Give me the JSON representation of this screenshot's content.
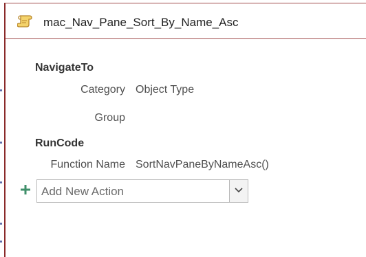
{
  "macro": {
    "title": "mac_Nav_Pane_Sort_By_Name_Asc",
    "title_icon": "macro-scroll-icon"
  },
  "actions": [
    {
      "name": "NavigateTo",
      "arguments": [
        {
          "label": "Category",
          "value": "Object Type"
        },
        {
          "label": "Group",
          "value": ""
        }
      ]
    },
    {
      "name": "RunCode",
      "arguments": [
        {
          "label": "Function Name",
          "value": "SortNavPaneByNameAsc()"
        }
      ]
    }
  ],
  "add_action": {
    "icon": "plus-icon",
    "placeholder": "Add New Action",
    "dropdown_icon": "chevron-down-icon"
  },
  "colors": {
    "border_accent": "#8a2a2a",
    "plus_green": "#3f8f6a",
    "text": "#404040"
  }
}
